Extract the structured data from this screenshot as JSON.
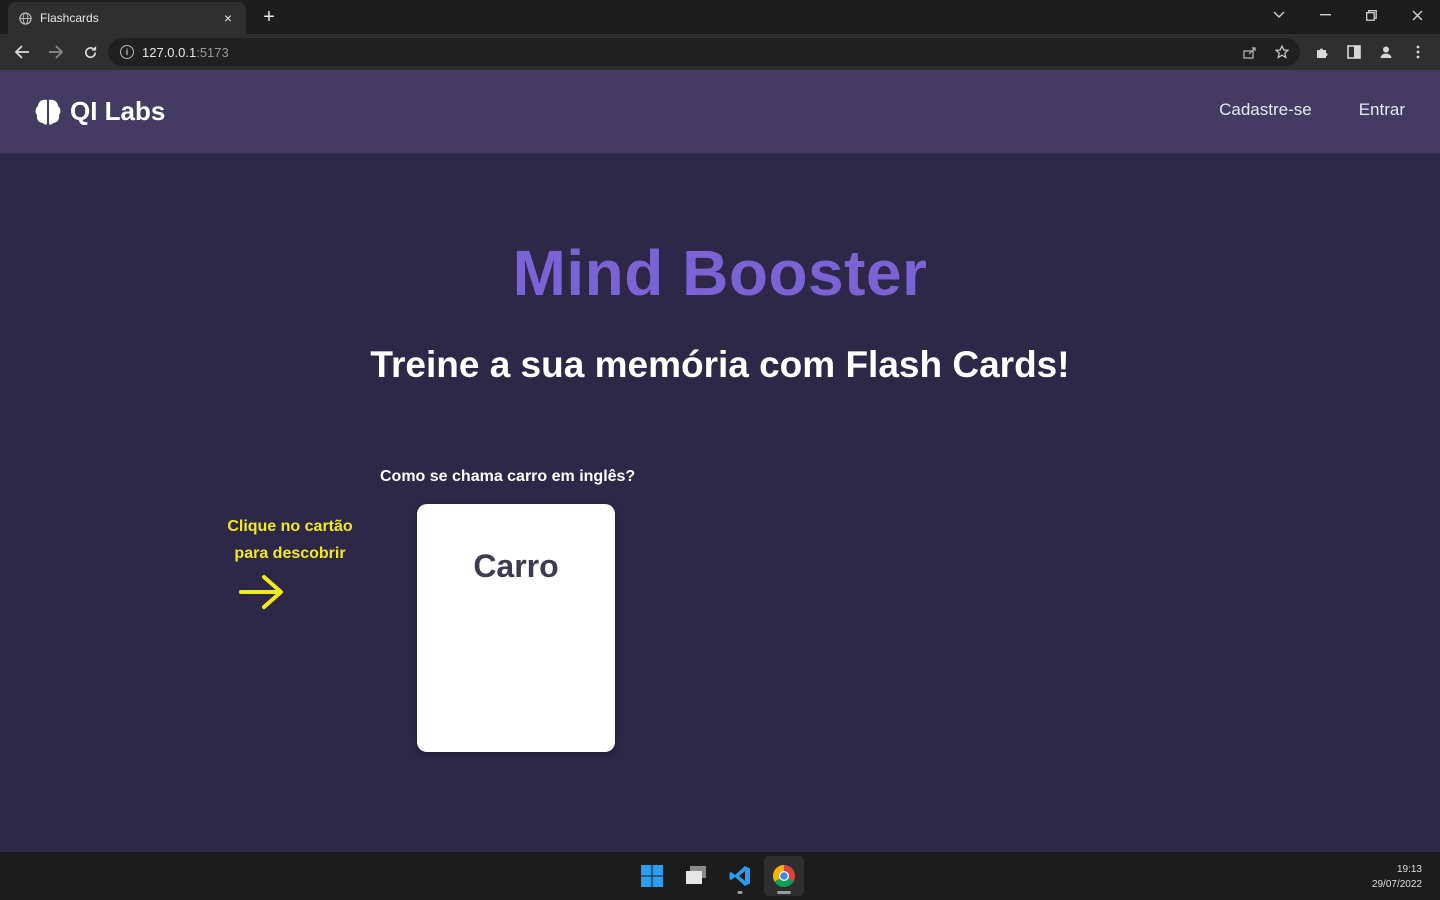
{
  "browser": {
    "tab_title": "Flashcards",
    "tab_close": "×",
    "new_tab": "+",
    "url_host": "127.0.0.1",
    "url_port": ":5173"
  },
  "header": {
    "brand": "QI Labs",
    "nav": [
      "Cadastre-se",
      "Entrar"
    ]
  },
  "hero": {
    "title": "Mind Booster",
    "subtitle": "Treine a sua memória com Flash Cards!"
  },
  "flashcard": {
    "question": "Como se chama carro em inglês?",
    "word": "Carro",
    "hint_line1": "Clique no cartão",
    "hint_line2": "para descobrir"
  },
  "taskbar": {
    "time": "19:13",
    "date": "29/07/2022"
  },
  "colors": {
    "page_bg": "#2d2748",
    "header_bg": "#433b61",
    "title_accent": "#7a63d4",
    "hint_yellow": "#f2ea1f"
  }
}
